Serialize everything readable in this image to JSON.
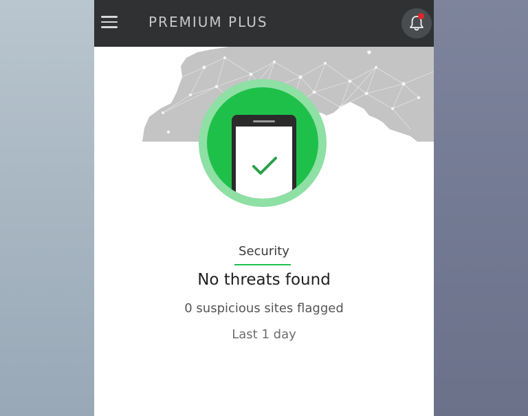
{
  "app": {
    "title": "PREMIUM PLUS"
  },
  "icons": {
    "menu": "hamburger-menu-icon",
    "notifications": "bell-icon",
    "status": "phone-check-icon"
  },
  "colors": {
    "app_bar": "#2f3133",
    "accent_green": "#1fc04a",
    "badge_ring": "#8ee0a4",
    "check_green": "#27a046",
    "notification_dot": "#e8222a",
    "map_gray": "#c4c4c4"
  },
  "security": {
    "category_label": "Security",
    "status_title": "No threats found",
    "detail": "0 suspicious sites flagged",
    "period": "Last 1 day"
  }
}
